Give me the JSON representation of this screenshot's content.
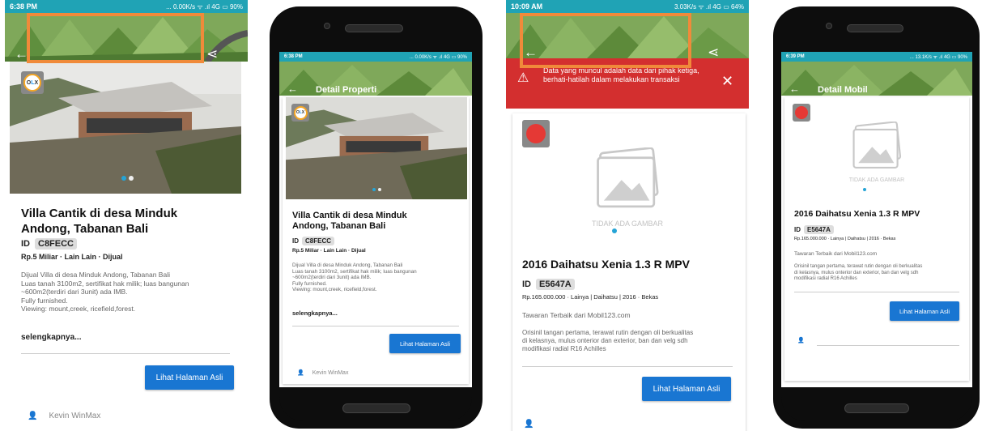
{
  "colors": {
    "statusbar_teal": "#20a3b5",
    "accent_orange": "#f08a3a",
    "warning_red": "#d32f2f",
    "button_blue": "#1976d2",
    "dot_blue": "#25a4d6"
  },
  "panel1": {
    "status_time": "6:38 PM",
    "status_right": "... 0.00K/s ᯤ .ıl 4G ▭ 90%",
    "back_icon": "back-arrow-icon",
    "share_icon": "share-icon",
    "bookmark_icon": "bookmark-icon",
    "logo_text": "OLX",
    "title": "Villa Cantik di desa Minduk Andong, Tabanan Bali",
    "id_label": "ID",
    "id_value": "C8FECC",
    "price_line": "Rp.5 Miliar · Lain Lain · Dijual",
    "desc": [
      "Dijual Villa di desa Minduk Andong, Tabanan Bali",
      "Luas tanah 3100m2, sertifikat hak milik; luas bangunan",
      "~600m2(terdiri dari 3unit) ada IMB.",
      "Fully furnished.",
      "Viewing: mount,creek, ricefield,forest."
    ],
    "more": "selengkapnya...",
    "button": "Lihat Halaman Asli",
    "user": "Kevin WinMax"
  },
  "panel2": {
    "status_time": "6:38 PM",
    "status_right": "... 0.00K/s ᯤ .ıl 4G ▭ 90%",
    "title_bar": "Detail Properti",
    "logo_text": "OLX",
    "title": "Villa Cantik di desa Minduk Andong, Tabanan Bali",
    "id_label": "ID",
    "id_value": "C8FECC",
    "price_line": "Rp.5 Miliar · Lain Lain · Dijual",
    "desc": [
      "Dijual Villa di desa Minduk Andong, Tabanan Bali",
      "Luas tanah 3100m2, sertifikat hak milik; luas bangunan",
      "~600m2(terdiri dari 3unit) ada IMB.",
      "Fully furnished.",
      "Viewing: mount,creek, ricefield,forest."
    ],
    "more": "selengkapnya...",
    "button": "Lihat Halaman Asli",
    "user": "Kevin WinMax"
  },
  "panel3": {
    "status_time": "10:09 AM",
    "status_right": "3.03K/s ᯤ .ıl 4G ▭ 64%",
    "warning": "Data yang muncul adalah data dari pihak ketiga, berhati-hatilah dalam melakukan transaksi",
    "no_image": "TIDAK ADA GAMBAR",
    "title": "2016 Daihatsu Xenia 1.3 R MPV",
    "id_label": "ID",
    "id_value": "E5647A",
    "price_line": "Rp.165.000.000 · Lainya | Daihatsu | 2016 · Bekas",
    "offer": "Tawaran Terbaik dari Mobil123.com",
    "desc": [
      "Orisinil tangan pertama, terawat rutin dengan oli berkualitas",
      "di kelasnya, mulus onterior dan exterior, ban dan velg sdh",
      "modifikasi radial R16 Achilles"
    ],
    "button": "Lihat Halaman Asli"
  },
  "panel4": {
    "status_time": "6:39 PM",
    "status_right": "... 13.1K/s ᯤ .ıl 4G ▭ 90%",
    "title_bar": "Detail Mobil",
    "no_image": "TIDAK ADA GAMBAR",
    "title": "2016 Daihatsu Xenia 1.3 R MPV",
    "id_label": "ID",
    "id_value": "E5647A",
    "price_line": "Rp.165.000.000 · Lainya | Daihatsu | 2016 · Bekas",
    "offer": "Tawaran Terbaik dari Mobil123.com",
    "desc": [
      "Orisinil tangan pertama, terawat rutin dengan oli berkualitas",
      "di kelasnya, mulus onterior dan exterior, ban dan velg sdh",
      "modifikasi radial R16 Achilles"
    ],
    "button": "Lihat Halaman Asli"
  }
}
